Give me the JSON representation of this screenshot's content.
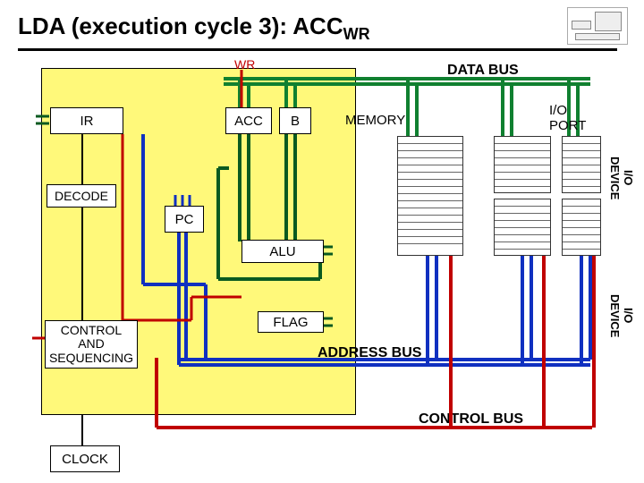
{
  "title_main": "LDA (execution cycle 3): ACC",
  "title_sub": "WR",
  "signals": {
    "wr": "WR"
  },
  "blocks": {
    "ir": "IR",
    "acc": "ACC",
    "b": "B",
    "decode": "DECODE",
    "pc": "PC",
    "alu": "ALU",
    "flag": "FLAG",
    "control": "CONTROL\nAND\nSEQUENCING",
    "clock": "CLOCK",
    "memory": "MEMORY",
    "ioport": "I/O\nPORT",
    "iodev": "I/O\nDEVICE"
  },
  "buses": {
    "data": "DATA BUS",
    "address": "ADDRESS BUS",
    "control": "CONTROL BUS"
  }
}
